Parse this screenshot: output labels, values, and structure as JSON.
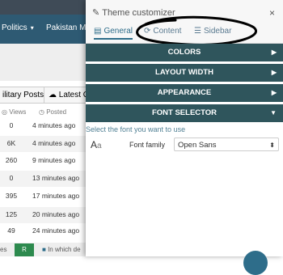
{
  "background": {
    "nav": {
      "item1": "Politics",
      "item2": "Pakistan Mil"
    },
    "tabs": {
      "tab1": "ilitary Posts",
      "tab2": "Latest O"
    },
    "columns": {
      "views": "Views",
      "posted": "Posted"
    },
    "rows": [
      {
        "views": "0",
        "time": "4 minutes ago"
      },
      {
        "views": "6K",
        "time": "4 minutes ago"
      },
      {
        "views": "260",
        "time": "9 minutes ago"
      },
      {
        "views": "0",
        "time": "13 minutes ago"
      },
      {
        "views": "395",
        "time": "17 minutes ago"
      },
      {
        "views": "125",
        "time": "20 minutes ago"
      },
      {
        "views": "49",
        "time": "24 minutes ago"
      }
    ],
    "footer": {
      "left": "es",
      "badge": "R",
      "text": "In which de"
    }
  },
  "panel": {
    "title": "Theme customizer",
    "close": "×",
    "tabs": [
      {
        "label": "General"
      },
      {
        "label": "Content"
      },
      {
        "label": "Sidebar"
      }
    ],
    "sections": {
      "colors": "COLORS",
      "layout_width": "LAYOUT WIDTH",
      "appearance": "APPEARANCE",
      "font_selector": "FONT SELECTOR"
    },
    "font": {
      "hint": "Select the font you want to use",
      "icon_text": "A",
      "icon_small": "a",
      "label": "Font family",
      "selected": "Open Sans"
    }
  },
  "colors": {
    "section_bar": "#2f555c",
    "accent": "#2e6d8a",
    "nav": "#2e5a73"
  }
}
